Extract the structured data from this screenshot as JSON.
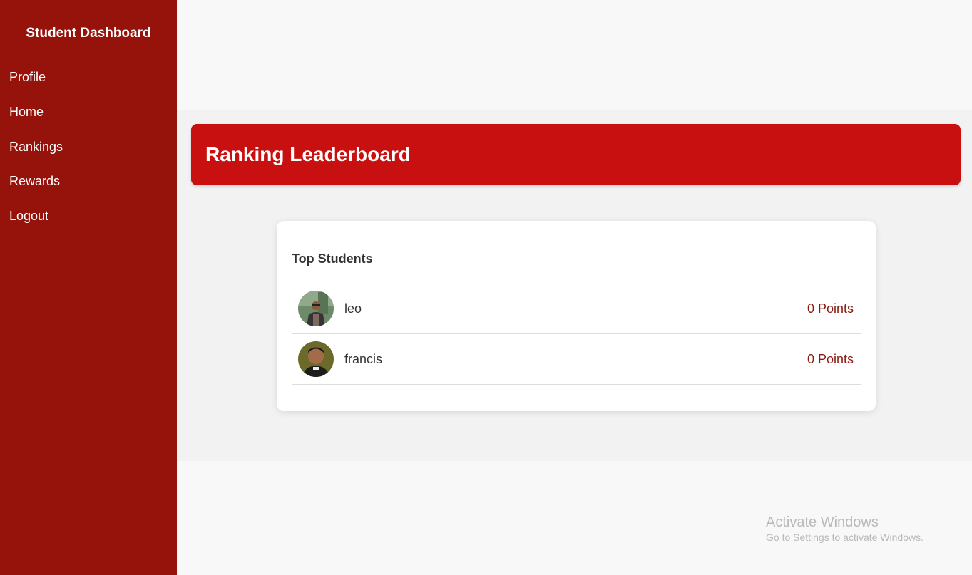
{
  "sidebar": {
    "title": "Student Dashboard",
    "items": [
      {
        "label": "Profile"
      },
      {
        "label": "Home"
      },
      {
        "label": "Rankings"
      },
      {
        "label": "Rewards"
      },
      {
        "label": "Logout"
      }
    ]
  },
  "banner": {
    "title": "Ranking Leaderboard"
  },
  "leaderboard": {
    "title": "Top Students",
    "students": [
      {
        "name": "leo",
        "points": "0 Points",
        "avatar_icon": "user-photo-avatar"
      },
      {
        "name": "francis",
        "points": "0 Points",
        "avatar_icon": "user-photo-avatar"
      }
    ]
  },
  "watermark": {
    "title": "Activate Windows",
    "subtitle": "Go to Settings to activate Windows."
  },
  "colors": {
    "sidebar": "#95130b",
    "banner": "#c81010",
    "points_text": "#8b1a10"
  }
}
